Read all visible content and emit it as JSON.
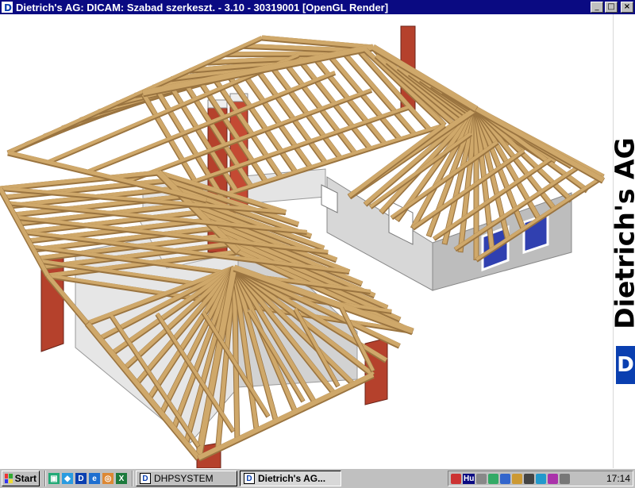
{
  "window": {
    "title": "Dietrich's AG: DICAM: Szabad szerkeszt. - 3.10 - 30319001 [OpenGL Render]",
    "buttons": {
      "minimize": "_",
      "maximize": "□",
      "close": "×"
    }
  },
  "banner": {
    "text": "Dietrich's AG",
    "logo": "D"
  },
  "taskbar": {
    "start_label": "Start",
    "quick_launch": [
      "desktop-icon",
      "explorer-icon",
      "dietrich-icon",
      "browser-icon",
      "media-icon",
      "excel-icon"
    ],
    "quick_glyphs": [
      "▣",
      "◆",
      "D",
      "e",
      "◎",
      "X"
    ],
    "tasks": [
      {
        "label": "DHPSYSTEM",
        "glyph": "D",
        "active": false
      },
      {
        "label": "Dietrich's AG...",
        "glyph": "D",
        "active": true
      }
    ],
    "tray": {
      "lang": "Hu",
      "clock": "17:14"
    }
  },
  "colors": {
    "titlebar": "#0a0a82",
    "timber": "#cfa86a",
    "timber_dark": "#9a7440",
    "wall": "#e8e8e8",
    "chimney": "#b5412c",
    "window_glass": "#3040b0",
    "logo": "#0a3fb0"
  }
}
